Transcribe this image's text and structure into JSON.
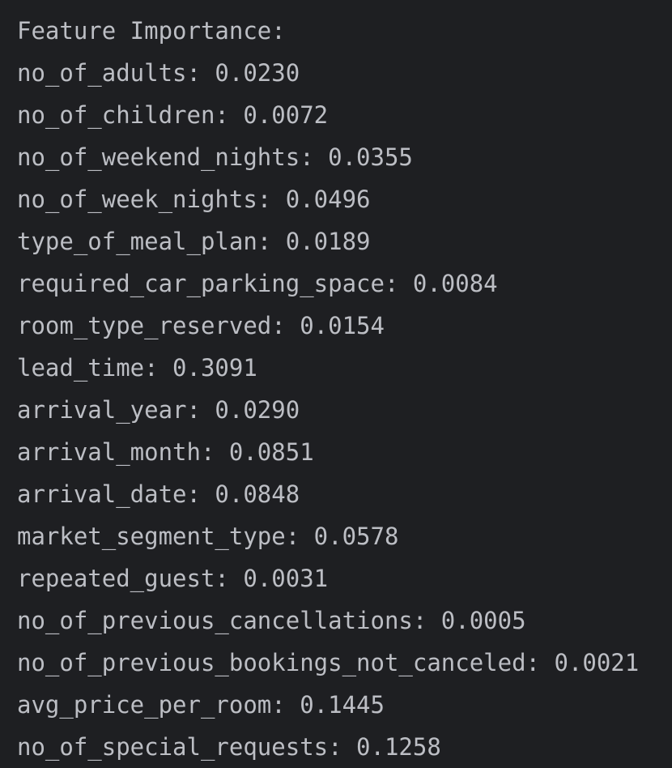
{
  "console": {
    "lines": [
      "Feature Importance:",
      "no_of_adults: 0.0230",
      "no_of_children: 0.0072",
      "no_of_weekend_nights: 0.0355",
      "no_of_week_nights: 0.0496",
      "type_of_meal_plan: 0.0189",
      "required_car_parking_space: 0.0084",
      "room_type_reserved: 0.0154",
      "lead_time: 0.3091",
      "arrival_year: 0.0290",
      "arrival_month: 0.0851",
      "arrival_date: 0.0848",
      "market_segment_type: 0.0578",
      "repeated_guest: 0.0031",
      "no_of_previous_cancellations: 0.0005",
      "no_of_previous_bookings_not_canceled: 0.0021",
      "avg_price_per_room: 0.1445",
      "no_of_special_requests: 0.1258"
    ]
  },
  "colors": {
    "background": "#1e1f22",
    "text": "#bcbec4"
  }
}
